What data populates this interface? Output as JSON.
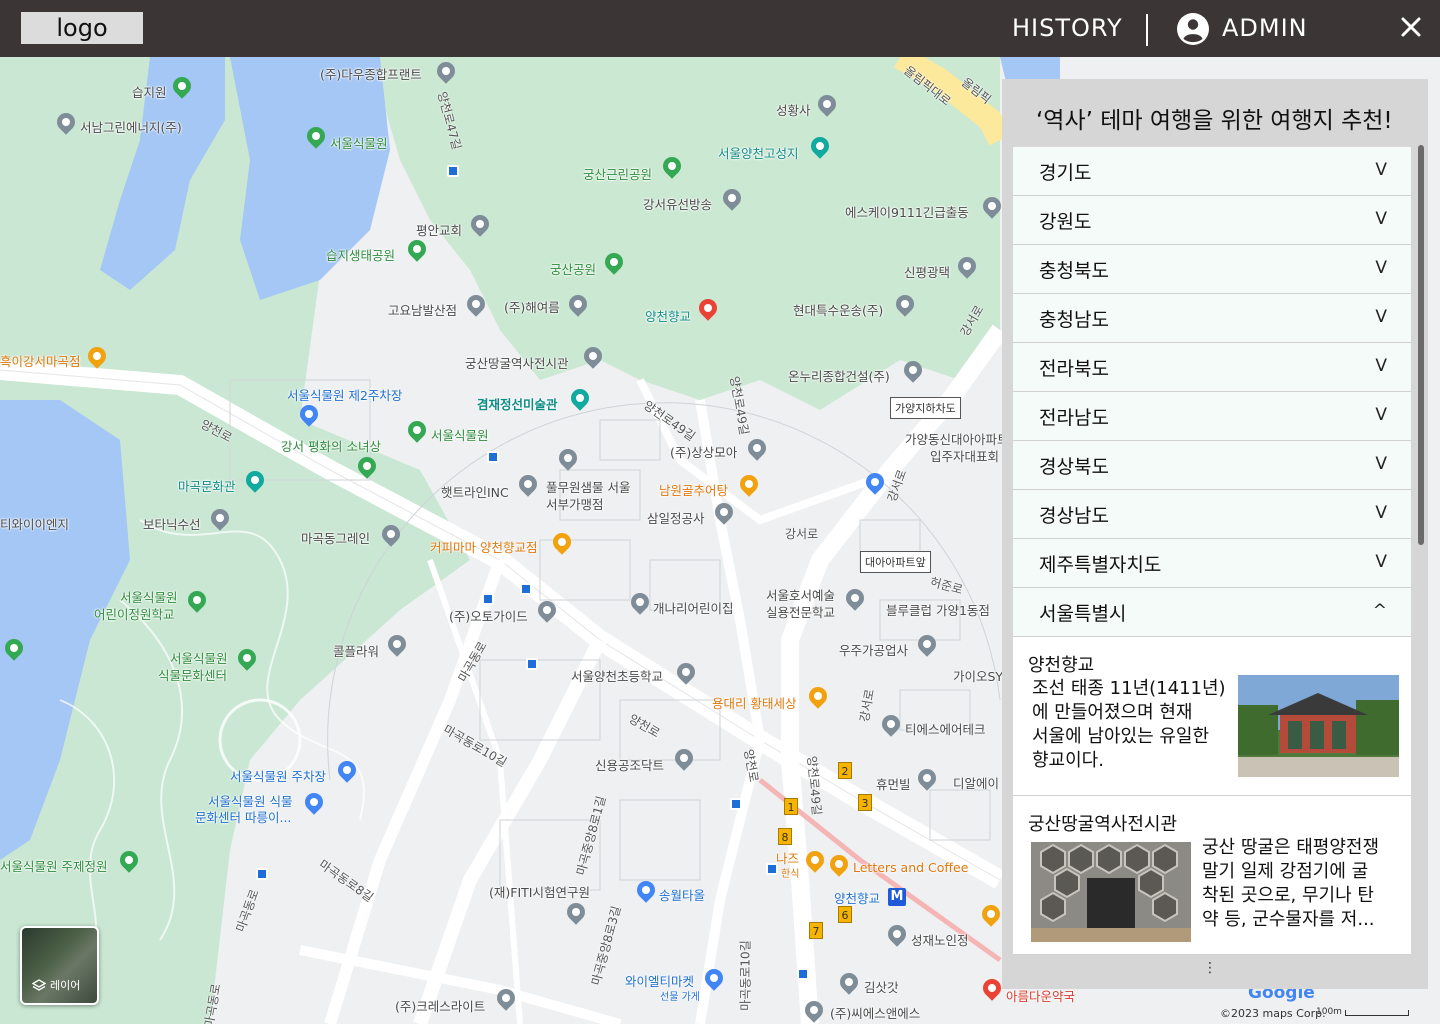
{
  "header": {
    "logo": "logo",
    "history": "HISTORY",
    "admin": "ADMIN"
  },
  "panel": {
    "title": "‘역사’ 테마 여행을 위한 여행지 추천!",
    "regions": [
      {
        "name": "경기도",
        "chevron": "V"
      },
      {
        "name": "강원도",
        "chevron": "V"
      },
      {
        "name": "충청북도",
        "chevron": "V"
      },
      {
        "name": "충청남도",
        "chevron": "V"
      },
      {
        "name": "전라북도",
        "chevron": "V"
      },
      {
        "name": "전라남도",
        "chevron": "V"
      },
      {
        "name": "경상북도",
        "chevron": "V"
      },
      {
        "name": "경상남도",
        "chevron": "V"
      },
      {
        "name": "제주특별자치도",
        "chevron": "V"
      },
      {
        "name": "서울특별시",
        "chevron": "^"
      }
    ],
    "places": [
      {
        "title": "양천향교",
        "desc": [
          "조선 태종 11년(1411년)",
          "에 만들어졌으며 현재",
          "서울에 남아있는 유일한",
          "향교이다."
        ]
      },
      {
        "title": "궁산땅굴역사전시관",
        "desc": [
          "궁산 땅굴은 태평양전쟁",
          "말기 일제 강점기에 굴",
          "착된 곳으로, 무기나 탄",
          "약 등, 군수물자를 저..."
        ]
      }
    ],
    "more": "⋮"
  },
  "map": {
    "layer_label": "레이어",
    "attribution": "©2023 maps Corp.",
    "google": "Google",
    "scale": "100m",
    "labels": [
      {
        "t": "(주)다우종합프랜트",
        "c": ""
      },
      {
        "t": "습지원",
        "c": ""
      },
      {
        "t": "서남그린에너지(주)",
        "c": ""
      },
      {
        "t": "서울식물원",
        "c": ""
      },
      {
        "t": "성황사",
        "c": ""
      },
      {
        "t": "서울양천고성지",
        "c": "teal"
      },
      {
        "t": "궁산근린공원",
        "c": ""
      },
      {
        "t": "강서유선방송",
        "c": ""
      },
      {
        "t": "에스케이9111긴급출동",
        "c": ""
      },
      {
        "t": "평안교회",
        "c": ""
      },
      {
        "t": "습지생태공원",
        "c": ""
      },
      {
        "t": "궁산공원",
        "c": ""
      },
      {
        "t": "신평광택",
        "c": ""
      },
      {
        "t": "고요남발산점",
        "c": ""
      },
      {
        "t": "(주)해여름",
        "c": ""
      },
      {
        "t": "양천향교",
        "c": "teal"
      },
      {
        "t": "현대특수운송(주)",
        "c": ""
      },
      {
        "t": "흑이강서마곡점",
        "c": "orange"
      },
      {
        "t": "궁산땅굴역사전시관",
        "c": ""
      },
      {
        "t": "온누리종합건설(주)",
        "c": ""
      },
      {
        "t": "서울식물원 제2주차장",
        "c": "blue"
      },
      {
        "t": "겸재정선미술관",
        "c": "teal"
      },
      {
        "t": "강서 평화의 소녀상",
        "c": ""
      },
      {
        "t": "서울식물원",
        "c": ""
      },
      {
        "t": "(주)상상모아",
        "c": ""
      },
      {
        "t": "가양동신대아아파트",
        "c": ""
      },
      {
        "t": "입주자대표회",
        "c": ""
      },
      {
        "t": "마곡문화관",
        "c": "teal"
      },
      {
        "t": "햇트라인INC",
        "c": ""
      },
      {
        "t": "풀무원샘물 서울",
        "c": ""
      },
      {
        "t": "서부가맹점",
        "c": ""
      },
      {
        "t": "남원골추어탕",
        "c": "orange"
      },
      {
        "t": "티와이이엔지",
        "c": ""
      },
      {
        "t": "보타닉수선",
        "c": ""
      },
      {
        "t": "삼일정공사",
        "c": ""
      },
      {
        "t": "마곡동그레인",
        "c": ""
      },
      {
        "t": "커피마마 양천향교점",
        "c": "orange"
      },
      {
        "t": "서울식물원",
        "c": ""
      },
      {
        "t": "어린이정원학교",
        "c": ""
      },
      {
        "t": "(주)오토가이드",
        "c": ""
      },
      {
        "t": "개나리어린이집",
        "c": ""
      },
      {
        "t": "서울호서예술",
        "c": ""
      },
      {
        "t": "실용전문학교",
        "c": ""
      },
      {
        "t": "블루클럽 가양1동점",
        "c": ""
      },
      {
        "t": "콜플라워",
        "c": ""
      },
      {
        "t": "우주가공업사",
        "c": ""
      },
      {
        "t": "서울식물원",
        "c": ""
      },
      {
        "t": "식물문화센터",
        "c": ""
      },
      {
        "t": "가이오SY",
        "c": ""
      },
      {
        "t": "서울양천초등학교",
        "c": ""
      },
      {
        "t": "용대리 황태세상",
        "c": "orange"
      },
      {
        "t": "티에스에어테크",
        "c": ""
      },
      {
        "t": "서울식물원 주차장",
        "c": "blue"
      },
      {
        "t": "신용공조닥트",
        "c": ""
      },
      {
        "t": "휴먼빌",
        "c": ""
      },
      {
        "t": "디알에이",
        "c": ""
      },
      {
        "t": "서울식물원 식물",
        "c": "blue"
      },
      {
        "t": "문화센터 따릉이...",
        "c": "blue"
      },
      {
        "t": "서울식물원 주제정원",
        "c": ""
      },
      {
        "t": "나즈",
        "c": "orange"
      },
      {
        "t": "한식",
        "c": "orange"
      },
      {
        "t": "Letters and Coffee",
        "c": "orange"
      },
      {
        "t": "양천향교",
        "c": "blue"
      },
      {
        "t": "(재)FITI시험연구원",
        "c": ""
      },
      {
        "t": "송월타올",
        "c": "blue"
      },
      {
        "t": "성재노인정",
        "c": ""
      },
      {
        "t": "와이엘티마켓",
        "c": "blue"
      },
      {
        "t": "선물 가게",
        "c": "blue"
      },
      {
        "t": "김삿갓",
        "c": ""
      },
      {
        "t": "아름다운약국",
        "c": "red"
      },
      {
        "t": "(주)크레스라이트",
        "c": ""
      },
      {
        "t": "(주)씨에스앤에스",
        "c": ""
      }
    ],
    "roads": [
      "양천로47길",
      "올림픽대로",
      "올림픽",
      "강서로",
      "양천로",
      "양천로49길",
      "양천로49길",
      "강서로",
      "허준로",
      "강서로",
      "마곡동로",
      "마곡동로10길",
      "양천로",
      "강서로",
      "양천로49길",
      "마곡중앙8로1길",
      "마곡동로8길",
      "마곡동로",
      "마곡중앙8로3길",
      "마곡동로10길",
      "마곡동로",
      "양천로"
    ],
    "boxes": [
      "가양지하차도",
      "대아아파트앞"
    ]
  }
}
